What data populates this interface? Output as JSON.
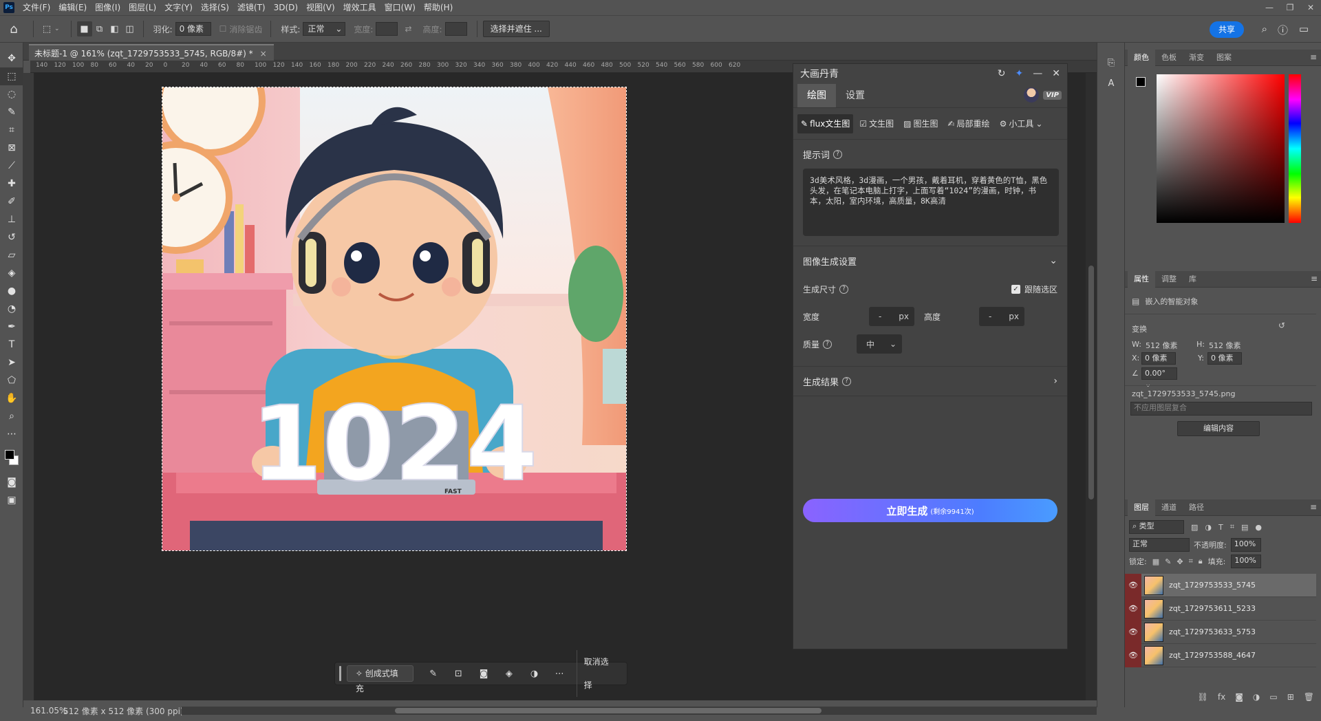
{
  "menu": {
    "logo": "Ps",
    "items": [
      "文件(F)",
      "编辑(E)",
      "图像(I)",
      "图层(L)",
      "文字(Y)",
      "选择(S)",
      "滤镜(T)",
      "3D(D)",
      "视图(V)",
      "增效工具",
      "窗口(W)",
      "帮助(H)"
    ]
  },
  "options": {
    "feather_label": "羽化:",
    "feather_value": "0 像素",
    "antialias_label": "消除锯齿",
    "style_label": "样式:",
    "style_value": "正常",
    "width_label": "宽度:",
    "height_label": "高度:",
    "select_mask_button": "选择并遮住 ...",
    "share_button": "共享"
  },
  "document": {
    "tab_title": "未标题-1 @ 161% (zqt_1729753533_5745, RGB/8#) *",
    "zoom": "161.05%",
    "size_info": "512 像素 x 512 像素 (300 ppi)"
  },
  "ruler": {
    "h_ticks": [
      "140",
      "120",
      "100",
      "80",
      "60",
      "40",
      "20",
      "0",
      "20",
      "40",
      "60",
      "80",
      "100",
      "120",
      "140",
      "160",
      "180",
      "200",
      "220",
      "240",
      "260",
      "280",
      "300",
      "320",
      "340",
      "360",
      "380",
      "400",
      "420",
      "440",
      "460",
      "480",
      "500",
      "520",
      "540",
      "560",
      "580",
      "600",
      "620"
    ]
  },
  "canvas_image": {
    "overlay_text": "1024",
    "laptop_label": "FAST"
  },
  "task_bar": {
    "generative_fill": "创成式填充",
    "deselect": "取消选择"
  },
  "plugin": {
    "title": "大画丹青",
    "tabs": [
      "绘图",
      "设置"
    ],
    "vip_badge": "VIP",
    "modes": [
      "flux文生图",
      "文生图",
      "图生图",
      "局部重绘",
      "小工具"
    ],
    "prompt_label": "提示词",
    "prompt_text": "3d美术风格，3d漫画，一个男孩，戴着耳机，穿着黄色的T恤，黑色头发，在笔记本电脑上打字，上面写着“1024”的漫画，时钟，书本，太阳，室内环境，高质量，8K高清",
    "gen_settings_label": "图像生成设置",
    "size_label": "生成尺寸",
    "follow_selection_label": "跟随选区",
    "width_label": "宽度",
    "width_value": "-",
    "height_label": "高度",
    "height_value": "-",
    "unit_px": "px",
    "quality_label": "质量",
    "quality_value": "中",
    "result_label": "生成结果",
    "generate_button": "立即生成",
    "generate_remaining": "(剩余9941次)"
  },
  "color_panel": {
    "tabs": [
      "颜色",
      "色板",
      "渐变",
      "图案"
    ]
  },
  "properties_panel": {
    "tabs": [
      "属性",
      "调整",
      "库"
    ],
    "object_type": "嵌入的智能对象",
    "transform_label": "变换",
    "w_label": "W:",
    "w_value": "512 像素",
    "h_label": "H:",
    "h_value": "512 像素",
    "x_label": "X:",
    "x_value": "0 像素",
    "y_label": "Y:",
    "y_value": "0 像素",
    "angle_value": "0.00°",
    "filename": "zqt_1729753533_5745.png",
    "comp_placeholder": "不应用图层复合",
    "edit_contents_button": "编辑内容"
  },
  "layers_panel": {
    "tabs": [
      "图层",
      "通道",
      "路径"
    ],
    "filter_label": "类型",
    "blend_mode": "正常",
    "opacity_label": "不透明度:",
    "opacity_value": "100%",
    "lock_label": "锁定:",
    "fill_label": "填充:",
    "fill_value": "100%",
    "layers": [
      {
        "name": "zqt_1729753533_5745",
        "selected": true
      },
      {
        "name": "zqt_1729753611_5233",
        "selected": false
      },
      {
        "name": "zqt_1729753633_5753",
        "selected": false
      },
      {
        "name": "zqt_1729753588_4647",
        "selected": false
      }
    ],
    "footer_fx": "fx"
  },
  "colors": {
    "accent_blue": "#1473e6",
    "visibility_red": "#7a2a2a",
    "generate_gradient_start": "#8a63ff",
    "generate_gradient_end": "#4a9cff"
  }
}
